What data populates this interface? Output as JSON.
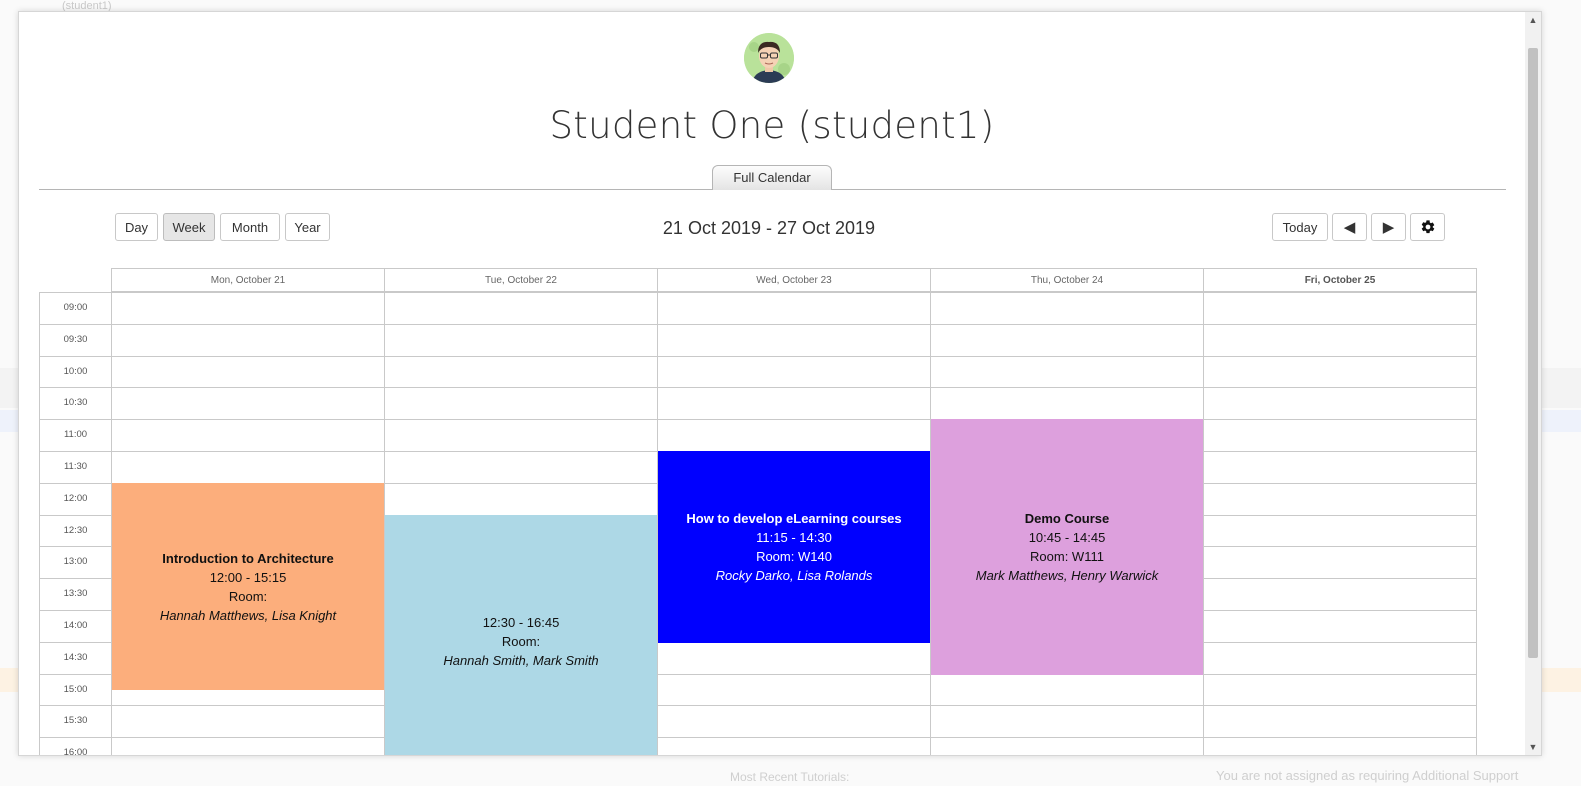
{
  "background": {
    "breadcrumb": "(student1)",
    "footer_left": "Most Recent Tutorials:",
    "footer_right": "You are not assigned as requiring Additional Support"
  },
  "profile": {
    "name": "Student One (student1)",
    "avatar_icon": "user-avatar-icon"
  },
  "tabs": [
    {
      "label": "Full Calendar"
    }
  ],
  "toolbar": {
    "views": [
      "Day",
      "Week",
      "Month",
      "Year"
    ],
    "active_view": "Week",
    "date_range": "21 Oct 2019 - 27 Oct 2019",
    "today_label": "Today",
    "prev_icon": "◀",
    "next_icon": "▶",
    "settings_icon": "gear-icon"
  },
  "calendar": {
    "days": [
      {
        "label": "Mon, October 21",
        "today": false
      },
      {
        "label": "Tue, October 22",
        "today": false
      },
      {
        "label": "Wed, October 23",
        "today": false
      },
      {
        "label": "Thu, October 24",
        "today": false
      },
      {
        "label": "Fri, October 25",
        "today": true
      }
    ],
    "times": [
      "09:00",
      "09:30",
      "10:00",
      "10:30",
      "11:00",
      "11:30",
      "12:00",
      "12:30",
      "13:00",
      "13:30",
      "14:00",
      "14:30",
      "15:00",
      "15:30",
      "16:00"
    ],
    "events": [
      {
        "day": 0,
        "start": "12:00",
        "end": "15:15",
        "title": "Introduction to Architecture",
        "time": "12:00 - 15:15",
        "room": "Room:",
        "people": "Hannah Matthews, Lisa Knight",
        "color": "#fcae7c",
        "text_color": "#111111"
      },
      {
        "day": 1,
        "start": "12:30",
        "end": "16:45",
        "title": "",
        "time": "12:30 - 16:45",
        "room": "Room:",
        "people": "Hannah Smith, Mark Smith",
        "color": "#add8e6",
        "text_color": "#111111"
      },
      {
        "day": 2,
        "start": "11:30",
        "end": "14:30",
        "title": "How to develop eLearning courses",
        "time": "11:15 - 14:30",
        "room": "Room: W140",
        "people": "Rocky Darko, Lisa Rolands",
        "color": "#0000ff",
        "text_color": "#ffffff"
      },
      {
        "day": 3,
        "start": "11:00",
        "end": "15:00",
        "title": "Demo Course",
        "time": "10:45 - 14:45",
        "room": "Room: W111",
        "people": "Mark Matthews, Henry Warwick",
        "color": "#dda0dd",
        "text_color": "#111111"
      }
    ]
  }
}
